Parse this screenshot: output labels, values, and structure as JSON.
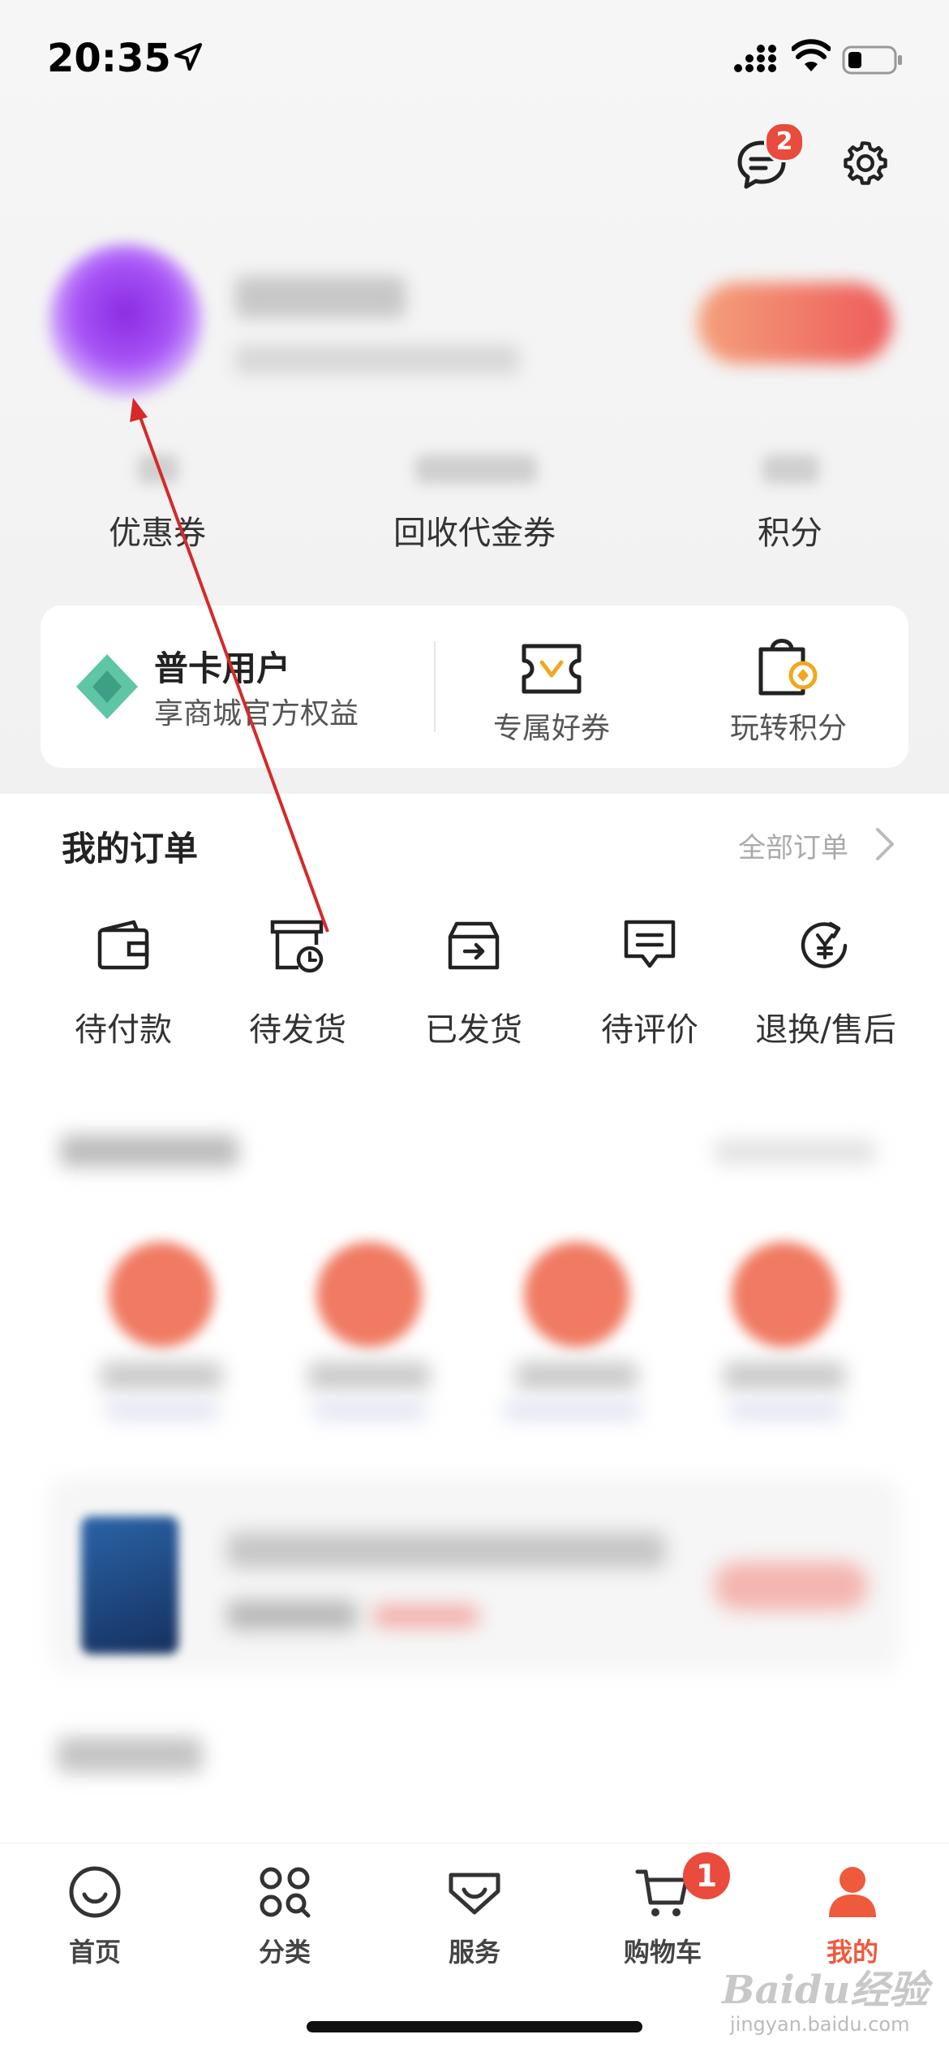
{
  "status_bar": {
    "time": "20:35"
  },
  "header": {
    "message_badge": "2"
  },
  "stats": [
    {
      "label": "优惠券"
    },
    {
      "label": "回收代金券"
    },
    {
      "label": "积分"
    }
  ],
  "member_card": {
    "title": "普卡用户",
    "subtitle": "享商城官方权益",
    "items": [
      {
        "label": "专属好券"
      },
      {
        "label": "玩转积分"
      }
    ]
  },
  "orders": {
    "title": "我的订单",
    "all_label": "全部订单",
    "items": [
      {
        "label": "待付款"
      },
      {
        "label": "待发货"
      },
      {
        "label": "已发货"
      },
      {
        "label": "待评价"
      },
      {
        "label": "退换/售后"
      }
    ]
  },
  "tabbar": {
    "items": [
      {
        "label": "首页",
        "icon": "smile-icon"
      },
      {
        "label": "分类",
        "icon": "grid-icon"
      },
      {
        "label": "服务",
        "icon": "service-icon"
      },
      {
        "label": "购物车",
        "icon": "cart-icon",
        "badge": "1"
      },
      {
        "label": "我的",
        "icon": "user-icon",
        "active": true
      }
    ]
  },
  "watermark": {
    "text": "Baidu经验",
    "url": "jingyan.baidu.com"
  },
  "colors": {
    "accent": "#ee5a3c",
    "badge": "#e94b3c",
    "arrow": "#d42a2a"
  }
}
